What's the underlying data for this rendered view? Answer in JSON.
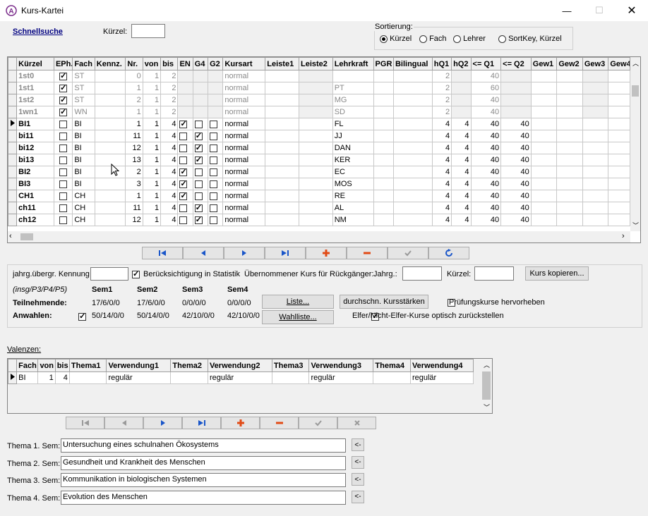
{
  "window": {
    "title": "Kurs-Kartei"
  },
  "quicksearch": {
    "link": "Schnellsuche",
    "kuerzel_label": "Kürzel:",
    "kuerzel_value": ""
  },
  "sort": {
    "label": "Sortierung:",
    "options": [
      "Kürzel",
      "Fach",
      "Lehrer",
      "SortKey, Kürzel"
    ],
    "selected": 0
  },
  "courses": {
    "columns": [
      "Kürzel",
      "EPh.",
      "Fach",
      "Kennz.",
      "Nr.",
      "von",
      "bis",
      "EN",
      "G4",
      "G2",
      "Kursart",
      "Leiste1",
      "Leiste2",
      "Lehrkraft",
      "PGR",
      "Bilingual",
      "hQ1",
      "hQ2",
      "<= Q1",
      "<= Q2",
      "Gew1",
      "Gew2",
      "Gew3",
      "Gew4"
    ],
    "rows": [
      {
        "k": "1st0",
        "eph": true,
        "fach": "ST",
        "nr": "0",
        "von": "1",
        "bis": "2",
        "en": null,
        "g4": null,
        "g2": null,
        "art": "normal",
        "lk": "",
        "hq1": "2",
        "hq2": "",
        "q1": "40",
        "q2": "",
        "gray": true
      },
      {
        "k": "1st1",
        "eph": true,
        "fach": "ST",
        "nr": "1",
        "von": "1",
        "bis": "2",
        "en": null,
        "g4": null,
        "g2": null,
        "art": "normal",
        "lk": "PT",
        "hq1": "2",
        "hq2": "",
        "q1": "60",
        "q2": "",
        "gray": true
      },
      {
        "k": "1st2",
        "eph": true,
        "fach": "ST",
        "nr": "2",
        "von": "1",
        "bis": "2",
        "en": null,
        "g4": null,
        "g2": null,
        "art": "normal",
        "lk": "MG",
        "hq1": "2",
        "hq2": "",
        "q1": "40",
        "q2": "",
        "gray": true
      },
      {
        "k": "1wn1",
        "eph": true,
        "fach": "WN",
        "nr": "1",
        "von": "1",
        "bis": "2",
        "en": null,
        "g4": null,
        "g2": null,
        "art": "normal",
        "lk": "SD",
        "hq1": "2",
        "hq2": "",
        "q1": "40",
        "q2": "",
        "gray": true
      },
      {
        "k": "BI1",
        "eph": false,
        "fach": "BI",
        "nr": "1",
        "von": "1",
        "bis": "4",
        "en": true,
        "g4": false,
        "g2": false,
        "art": "normal",
        "lk": "FL",
        "hq1": "4",
        "hq2": "4",
        "q1": "40",
        "q2": "40",
        "current": true
      },
      {
        "k": "bi11",
        "eph": false,
        "fach": "BI",
        "nr": "11",
        "von": "1",
        "bis": "4",
        "en": false,
        "g4": true,
        "g2": false,
        "art": "normal",
        "lk": "JJ",
        "hq1": "4",
        "hq2": "4",
        "q1": "40",
        "q2": "40"
      },
      {
        "k": "bi12",
        "eph": false,
        "fach": "BI",
        "nr": "12",
        "von": "1",
        "bis": "4",
        "en": false,
        "g4": true,
        "g2": false,
        "art": "normal",
        "lk": "DAN",
        "hq1": "4",
        "hq2": "4",
        "q1": "40",
        "q2": "40"
      },
      {
        "k": "bi13",
        "eph": false,
        "fach": "BI",
        "nr": "13",
        "von": "1",
        "bis": "4",
        "en": false,
        "g4": true,
        "g2": false,
        "art": "normal",
        "lk": "KER",
        "hq1": "4",
        "hq2": "4",
        "q1": "40",
        "q2": "40"
      },
      {
        "k": "BI2",
        "eph": false,
        "fach": "BI",
        "nr": "2",
        "von": "1",
        "bis": "4",
        "en": true,
        "g4": false,
        "g2": false,
        "art": "normal",
        "lk": "EC",
        "hq1": "4",
        "hq2": "4",
        "q1": "40",
        "q2": "40"
      },
      {
        "k": "BI3",
        "eph": false,
        "fach": "BI",
        "nr": "3",
        "von": "1",
        "bis": "4",
        "en": true,
        "g4": false,
        "g2": false,
        "art": "normal",
        "lk": "MOS",
        "hq1": "4",
        "hq2": "4",
        "q1": "40",
        "q2": "40"
      },
      {
        "k": "CH1",
        "eph": false,
        "fach": "CH",
        "nr": "1",
        "von": "1",
        "bis": "4",
        "en": true,
        "g4": false,
        "g2": false,
        "art": "normal",
        "lk": "RE",
        "hq1": "4",
        "hq2": "4",
        "q1": "40",
        "q2": "40"
      },
      {
        "k": "ch11",
        "eph": false,
        "fach": "CH",
        "nr": "11",
        "von": "1",
        "bis": "4",
        "en": false,
        "g4": true,
        "g2": false,
        "art": "normal",
        "lk": "AL",
        "hq1": "4",
        "hq2": "4",
        "q1": "40",
        "q2": "40"
      },
      {
        "k": "ch12",
        "eph": false,
        "fach": "CH",
        "nr": "12",
        "von": "1",
        "bis": "4",
        "en": false,
        "g4": true,
        "g2": false,
        "art": "normal",
        "lk": "NM",
        "hq1": "4",
        "hq2": "4",
        "q1": "40",
        "q2": "40"
      }
    ]
  },
  "nav1": [
    "first",
    "prev",
    "next",
    "last",
    "add",
    "delete",
    "post",
    "refresh"
  ],
  "details": {
    "kennung_label": "jahrg.übergr. Kennung",
    "statistik_label": "Berücksichtigung in Statistik",
    "statistik_checked": true,
    "uebernommen_label": "Übernommener Kurs für Rückgänger:",
    "jahrg_label": "Jahrg.:",
    "kuerzel_label": "Kürzel:",
    "kopieren_button": "Kurs kopieren...",
    "sem_hint": "(insg/P3/P4/P5)",
    "sem_headers": [
      "Sem1",
      "Sem2",
      "Sem3",
      "Sem4"
    ],
    "teilnehmende_label": "Teilnehmende:",
    "teilnehmende": [
      "17/6/0/0",
      "17/6/0/0",
      "0/0/0/0",
      "0/0/0/0"
    ],
    "anwahlen_label": "Anwahlen:",
    "anwahlen_checked": true,
    "anwahlen": [
      "50/14/0/0",
      "50/14/0/0",
      "42/10/0/0",
      "42/10/0/0"
    ],
    "liste_button": "Liste...",
    "wahlliste_button": "Wahlliste...",
    "kursstaerken_button": "durchschn. Kursstärken",
    "pruefung_label": "Prüfungskurse hervorheben",
    "pruefung_checked": false,
    "elfer_label": "Elfer/Nicht-Elfer-Kurse optisch zurückstellen",
    "elfer_checked": true
  },
  "valenzen": {
    "label": "Valenzen:",
    "columns": [
      "Fach",
      "von",
      "bis",
      "Thema1",
      "Verwendung1",
      "Thema2",
      "Verwendung2",
      "Thema3",
      "Verwendung3",
      "Thema4",
      "Verwendung4"
    ],
    "rows": [
      {
        "fach": "BI",
        "von": "1",
        "bis": "4",
        "t1": "",
        "v1": "regulär",
        "t2": "",
        "v2": "regulär",
        "t3": "",
        "v3": "regulär",
        "t4": "",
        "v4": "regulär"
      }
    ]
  },
  "themes": [
    {
      "label": "Thema 1. Sem:",
      "value": "Untersuchung eines schulnahen Ökosystems"
    },
    {
      "label": "Thema 2. Sem:",
      "value": "Gesundheit und Krankheit des Menschen"
    },
    {
      "label": "Thema 3. Sem:",
      "value": "Kommunikation in biologischen Systemen"
    },
    {
      "label": "Thema 4. Sem:",
      "value": "Evolution des Menschen"
    }
  ],
  "theme_button": "<-",
  "colors": {
    "nav_blue": "#1a56c9",
    "add_red": "#e14b16"
  }
}
